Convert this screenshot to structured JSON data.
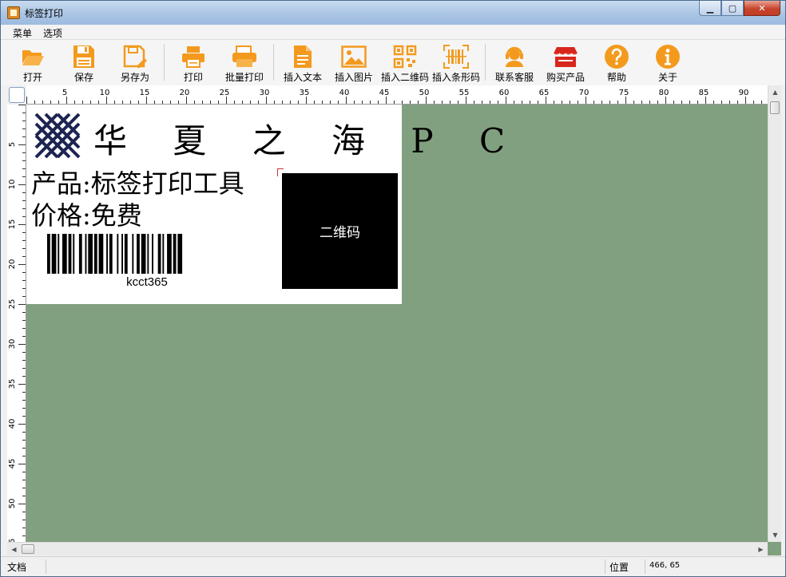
{
  "window": {
    "title": "标签打印",
    "minimize": "▁",
    "maximize": "▢",
    "close": "✕"
  },
  "menu": [
    {
      "label": "菜单"
    },
    {
      "label": "选项"
    }
  ],
  "toolbar": [
    {
      "label": "打开",
      "icon": "folder-open-icon"
    },
    {
      "label": "保存",
      "icon": "save-icon"
    },
    {
      "label": "另存为",
      "icon": "save-as-icon"
    },
    {
      "label": "打印",
      "icon": "printer-icon"
    },
    {
      "label": "批量打印",
      "icon": "batch-print-icon"
    },
    {
      "label": "插入文本",
      "icon": "text-document-icon"
    },
    {
      "label": "插入图片",
      "icon": "image-icon"
    },
    {
      "label": "插入二维码",
      "icon": "qr-code-icon"
    },
    {
      "label": "插入条形码",
      "icon": "barcode-icon"
    },
    {
      "label": "联系客服",
      "icon": "customer-service-icon"
    },
    {
      "label": "购买产品",
      "icon": "shop-icon"
    },
    {
      "label": "帮助",
      "icon": "help-icon"
    },
    {
      "label": "关于",
      "icon": "info-icon"
    }
  ],
  "ruler": {
    "h_labels": [
      "5",
      "10",
      "15",
      "20",
      "25",
      "30",
      "35",
      "40",
      "45",
      "50",
      "55",
      "60",
      "65",
      "70",
      "75",
      "80",
      "85",
      "90"
    ],
    "v_labels": [
      "5",
      "10",
      "15",
      "20",
      "25",
      "30",
      "35",
      "40",
      "45",
      "50",
      "55"
    ]
  },
  "label": {
    "brand": "华 夏 之 海 P C",
    "product": "产品:标签打印工具",
    "price": "价格:免费",
    "barcode_text": "kcct365",
    "qr_text": "二维码"
  },
  "status": {
    "doc": "文档",
    "position_label": "位置",
    "position_value": "466, 65"
  },
  "colors": {
    "accent": "#f39a1e",
    "canvas_bg": "#81a07f",
    "shop_red": "#d9261c"
  }
}
